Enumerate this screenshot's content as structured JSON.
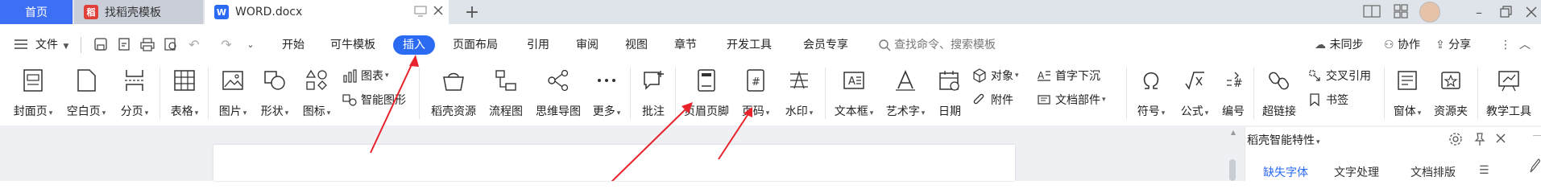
{
  "tabs": {
    "home": "首页",
    "template": "找稻壳模板",
    "doc": "WORD.docx",
    "doc_icon": "W",
    "template_icon": "稻"
  },
  "menubar": {
    "file": "文件",
    "items": [
      "开始",
      "可牛模板",
      "插入",
      "页面布局",
      "引用",
      "审阅",
      "视图",
      "章节",
      "开发工具",
      "会员专享"
    ],
    "search_placeholder": "查找命令、搜索模板",
    "sync": "未同步",
    "collab": "协作",
    "share": "分享"
  },
  "ribbon": {
    "cover": "封面页",
    "blank": "空白页",
    "section": "分页",
    "table": "表格",
    "picture": "图片",
    "shape": "形状",
    "icon": "图标",
    "chart": "图表",
    "smartart": "智能图形",
    "daoke": "稻壳资源",
    "flow": "流程图",
    "mindmap": "思维导图",
    "more": "更多",
    "comment": "批注",
    "header_footer": "页眉页脚",
    "page_number": "页码",
    "watermark": "水印",
    "textbox": "文本框",
    "wordart": "艺术字",
    "date": "日期",
    "object": "对象",
    "attachment": "附件",
    "dropcap": "首字下沉",
    "docpart": "文档部件",
    "symbol": "符号",
    "formula": "公式",
    "numbering": "编号",
    "hyperlink": "超链接",
    "crossref": "交叉引用",
    "bookmark": "书签",
    "form": "窗体",
    "resource": "资源夹",
    "teaching": "教学工具"
  },
  "panel": {
    "title": "稻壳智能特性",
    "tabs": [
      "缺失字体",
      "文字处理",
      "文档排版"
    ]
  },
  "colors": {
    "accent": "#2b6bf3",
    "annotation_arrow": "#e8232c"
  }
}
